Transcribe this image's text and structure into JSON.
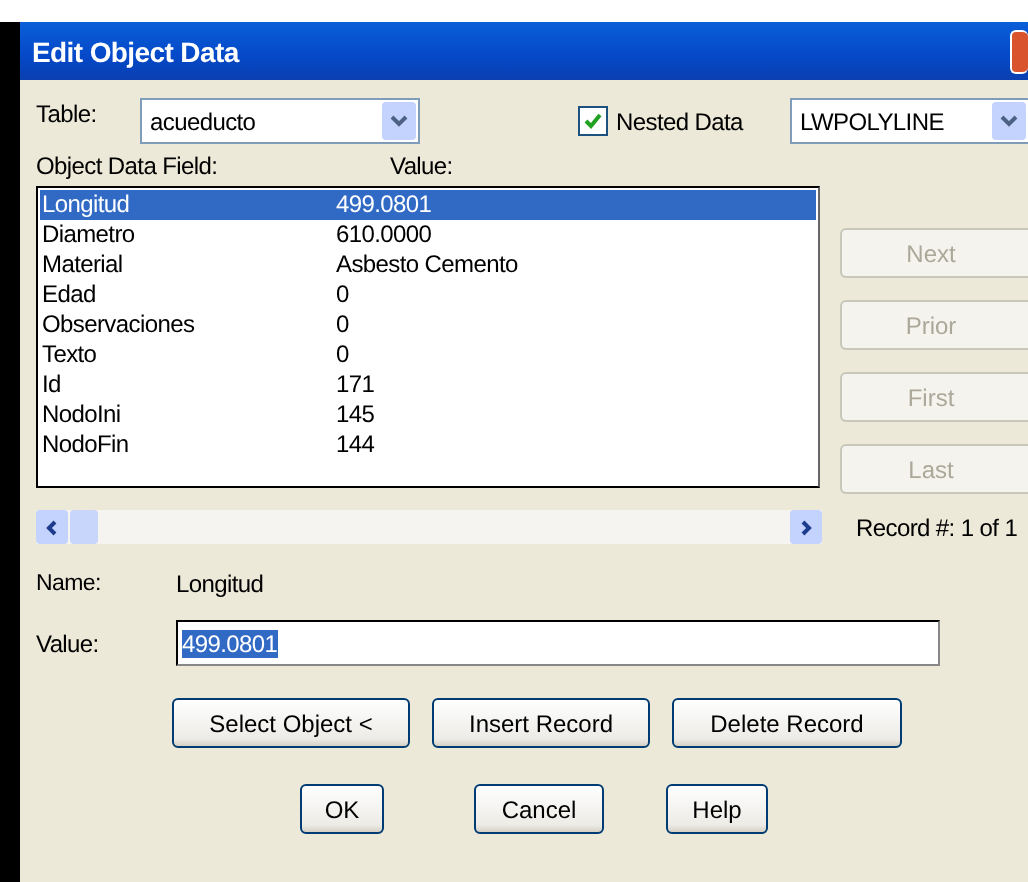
{
  "window": {
    "title": "Edit Object Data"
  },
  "table": {
    "label": "Table:",
    "value": "acueducto"
  },
  "nested_data": {
    "label": "Nested Data",
    "checked": true
  },
  "object_type": {
    "value": "LWPOLYLINE"
  },
  "list_headers": [
    "Object Data Field:",
    "Value:"
  ],
  "fields": [
    {
      "name": "Longitud",
      "value": "499.0801",
      "selected": true
    },
    {
      "name": "Diametro",
      "value": "610.0000",
      "selected": false
    },
    {
      "name": "Material",
      "value": "Asbesto Cemento",
      "selected": false
    },
    {
      "name": "Edad",
      "value": "0",
      "selected": false
    },
    {
      "name": "Observaciones",
      "value": "0",
      "selected": false
    },
    {
      "name": "Texto",
      "value": "0",
      "selected": false
    },
    {
      "name": "Id",
      "value": "171",
      "selected": false
    },
    {
      "name": "NodoIni",
      "value": "145",
      "selected": false
    },
    {
      "name": "NodoFin",
      "value": "144",
      "selected": false
    }
  ],
  "nav_buttons": [
    {
      "label": "Next",
      "disabled": true
    },
    {
      "label": "Prior",
      "disabled": true
    },
    {
      "label": "First",
      "disabled": true
    },
    {
      "label": "Last",
      "disabled": true
    }
  ],
  "record": "Record #: 1 of 1",
  "name": {
    "label": "Name:",
    "value": "Longitud"
  },
  "value": {
    "label": "Value:",
    "value": "499.0801",
    "text_selected": true
  },
  "action_buttons": [
    "Select Object <",
    "Insert Record",
    "Delete Record"
  ],
  "dialog_buttons": [
    "OK",
    "Cancel",
    "Help"
  ]
}
